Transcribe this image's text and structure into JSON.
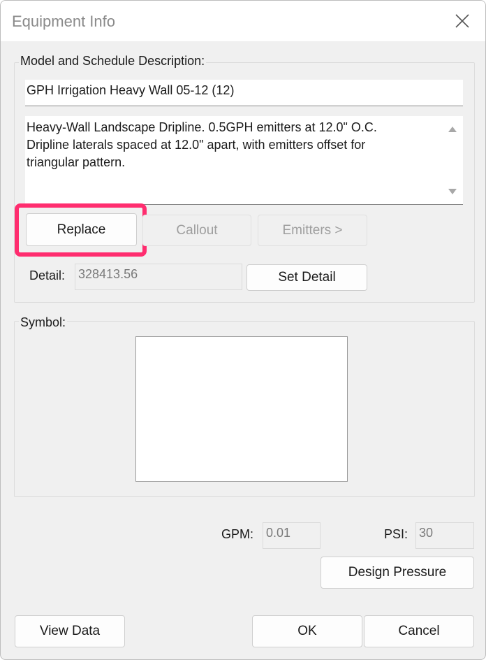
{
  "window": {
    "title": "Equipment Info"
  },
  "model_group": {
    "label": "Model and Schedule Description:",
    "model_name": "GPH Irrigation Heavy Wall 05-12 (12)",
    "description_lines": [
      "Heavy-Wall Landscape Dripline. 0.5GPH emitters at 12.0\" O.C.",
      "Dripline laterals spaced at 12.0\" apart, with emitters offset for",
      "triangular pattern."
    ],
    "buttons": {
      "replace": "Replace",
      "callout": "Callout",
      "emitters": "Emitters >"
    },
    "detail_label": "Detail:",
    "detail_value": "328413.56",
    "set_detail": "Set Detail"
  },
  "symbol_group": {
    "label": "Symbol:"
  },
  "flow": {
    "gpm_label": "GPM:",
    "gpm_value": "0.01",
    "psi_label": "PSI:",
    "psi_value": "30",
    "design_pressure": "Design Pressure"
  },
  "footer": {
    "view_data": "View Data",
    "ok": "OK",
    "cancel": "Cancel"
  },
  "colors": {
    "highlight": "#ff2d6f",
    "window_bg": "#f0f0f0"
  },
  "icons": {
    "close": "close-icon",
    "scroll_up": "scroll-up-icon",
    "scroll_down": "scroll-down-icon"
  }
}
